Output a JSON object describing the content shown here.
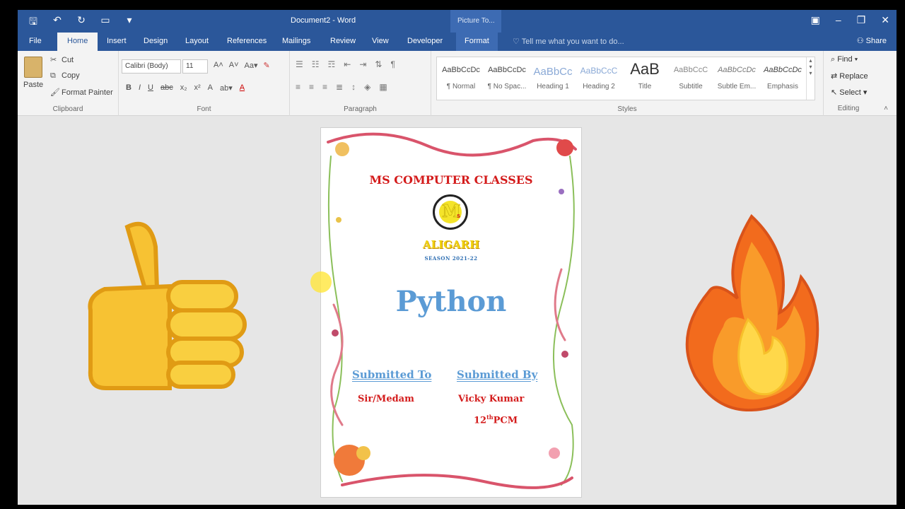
{
  "window": {
    "title": "Document2 - Word",
    "context_tab_group": "Picture To...",
    "colors": {
      "brand": "#2b579a",
      "ribbon": "#f3f3f3",
      "canvas": "#e6e6e6"
    }
  },
  "qat_icons": [
    "save-icon",
    "undo-icon",
    "redo-icon",
    "new-doc-icon",
    "customize-icon"
  ],
  "tabs": [
    "File",
    "Home",
    "Insert",
    "Design",
    "Layout",
    "References",
    "Mailings",
    "Review",
    "View",
    "Developer",
    "Format"
  ],
  "tell_me": "Tell me what you want to do...",
  "share": "Share",
  "clipboard": {
    "paste": "Paste",
    "cut": "Cut",
    "copy": "Copy",
    "format_painter": "Format Painter",
    "label": "Clipboard"
  },
  "font": {
    "name": "Calibri (Body)",
    "size": "11",
    "label": "Font"
  },
  "paragraph": {
    "label": "Paragraph"
  },
  "styles": {
    "label": "Styles",
    "items": [
      {
        "sample": "AaBbCcDc",
        "name": "¶ Normal"
      },
      {
        "sample": "AaBbCcDc",
        "name": "¶ No Spac..."
      },
      {
        "sample": "AaBbCc",
        "name": "Heading 1"
      },
      {
        "sample": "AaBbCcC",
        "name": "Heading 2"
      },
      {
        "sample": "AaB",
        "name": "Title"
      },
      {
        "sample": "AaBbCcC",
        "name": "Subtitle"
      },
      {
        "sample": "AaBbCcDc",
        "name": "Subtle Em..."
      },
      {
        "sample": "AaBbCcDc",
        "name": "Emphasis"
      }
    ]
  },
  "editing": {
    "find": "Find",
    "replace": "Replace",
    "select": "Select",
    "label": "Editing"
  },
  "document": {
    "org": "MS COMPUTER CLASSES",
    "logo_letter": "M",
    "logo_sub": "s",
    "city": "ALIGARH",
    "season": "SEASON 2021-22",
    "subject": "Python",
    "submitted_to_label": "Submitted To",
    "submitted_to": "Sir/Medam",
    "submitted_by_label": "Submitted By",
    "submitted_by": "Vicky Kumar",
    "class": "12",
    "class_sup": "th",
    "class_stream": "PCM"
  },
  "overlays": [
    "thumbs-up-emoji",
    "fire-emoji"
  ]
}
